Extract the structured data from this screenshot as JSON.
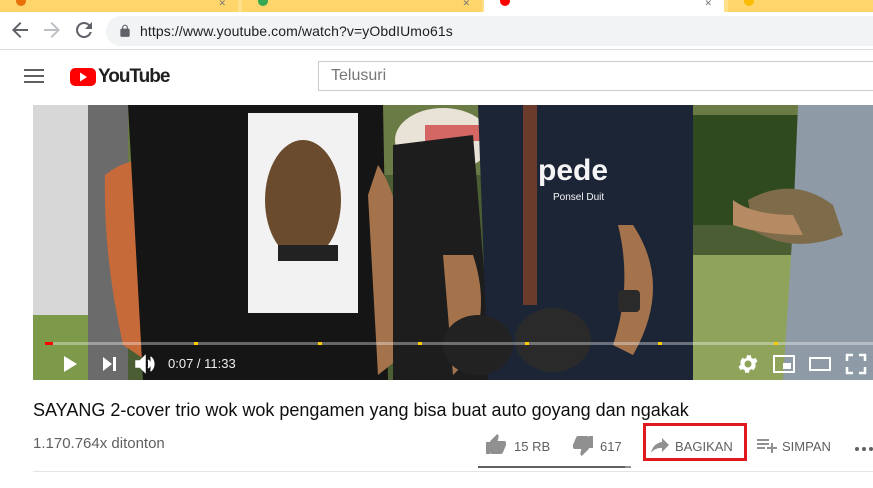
{
  "browser": {
    "url": "https://www.youtube.com/watch?v=yObdIUmo61s",
    "tabs": [
      {
        "favicon_color": "#e8710a"
      },
      {
        "favicon_color": "#34a853"
      },
      {
        "favicon_color": "#ff0000"
      },
      {
        "favicon_color": "#fbbc04"
      }
    ]
  },
  "youtube": {
    "logo_text": "YouTube",
    "search_placeholder": "Telusuri"
  },
  "player": {
    "time_display": "0:07 / 11:33",
    "progress_fraction": 0.01,
    "chapter_marks_fraction": [
      0.18,
      0.33,
      0.45,
      0.58,
      0.74,
      0.88
    ],
    "colors": {
      "progress": "#ff0000",
      "marker": "#ffcc00"
    }
  },
  "video": {
    "title": "SAYANG 2-cover trio wok wok pengamen yang bisa buat auto goyang dan ngakak",
    "views": "1.170.764x ditonton",
    "likes": "15 RB",
    "dislikes": "617",
    "share_label": "BAGIKAN",
    "save_label": "SIMPAN",
    "like_ratio": 0.96
  },
  "annotation": {
    "highlight_color": "#e0191f"
  }
}
